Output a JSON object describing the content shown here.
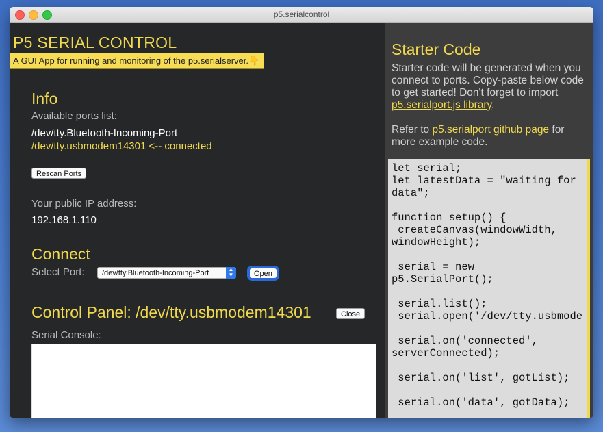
{
  "window": {
    "title": "p5.serialcontrol"
  },
  "app": {
    "title": "P5 SERIAL CONTROL",
    "subtitle": "A GUI App for running and monitoring of the p5.serialserver.👇"
  },
  "info": {
    "heading": "Info",
    "ports_label": "Available ports list:",
    "ports": [
      {
        "name": "/dev/tty.Bluetooth-Incoming-Port",
        "status": ""
      },
      {
        "name": "/dev/tty.usbmodem14301 <-- connected",
        "status": "connected"
      }
    ],
    "rescan_label": "Rescan Ports",
    "ip_label": "Your public IP address:",
    "ip_value": "192.168.1.110"
  },
  "connect": {
    "heading": "Connect",
    "select_label": "Select Port:",
    "selected_port": "/dev/tty.Bluetooth-Incoming-Port",
    "open_label": "Open"
  },
  "control_panel": {
    "heading": "Control Panel: /dev/tty.usbmodem14301",
    "close_label": "Close",
    "console_label": "Serial Console:"
  },
  "starter": {
    "heading": "Starter Code",
    "intro": "Starter code will be generated when you connect to ports. Copy-paste below code to get started! Don't forget to import ",
    "library_link": "p5.serialport.js library",
    "intro_end": ".",
    "refer_prefix": "Refer to ",
    "github_link": "p5.serialport github page",
    "refer_suffix": " for more example code.",
    "code": "let serial;\nlet latestData = \"waiting for\ndata\";\n\nfunction setup() {\n createCanvas(windowWidth,\nwindowHeight);\n\n serial = new\np5.SerialPort();\n\n serial.list();\n serial.open('/dev/tty.usbmode\n\n serial.on('connected',\nserverConnected);\n\n serial.on('list', gotList);\n\n serial.on('data', gotData);\n\n serial.on('error',"
  },
  "colors": {
    "accent": "#f1d94e",
    "left_bg": "#262729",
    "right_bg": "#3d3d3e",
    "focus_blue": "#2a6ad8"
  }
}
